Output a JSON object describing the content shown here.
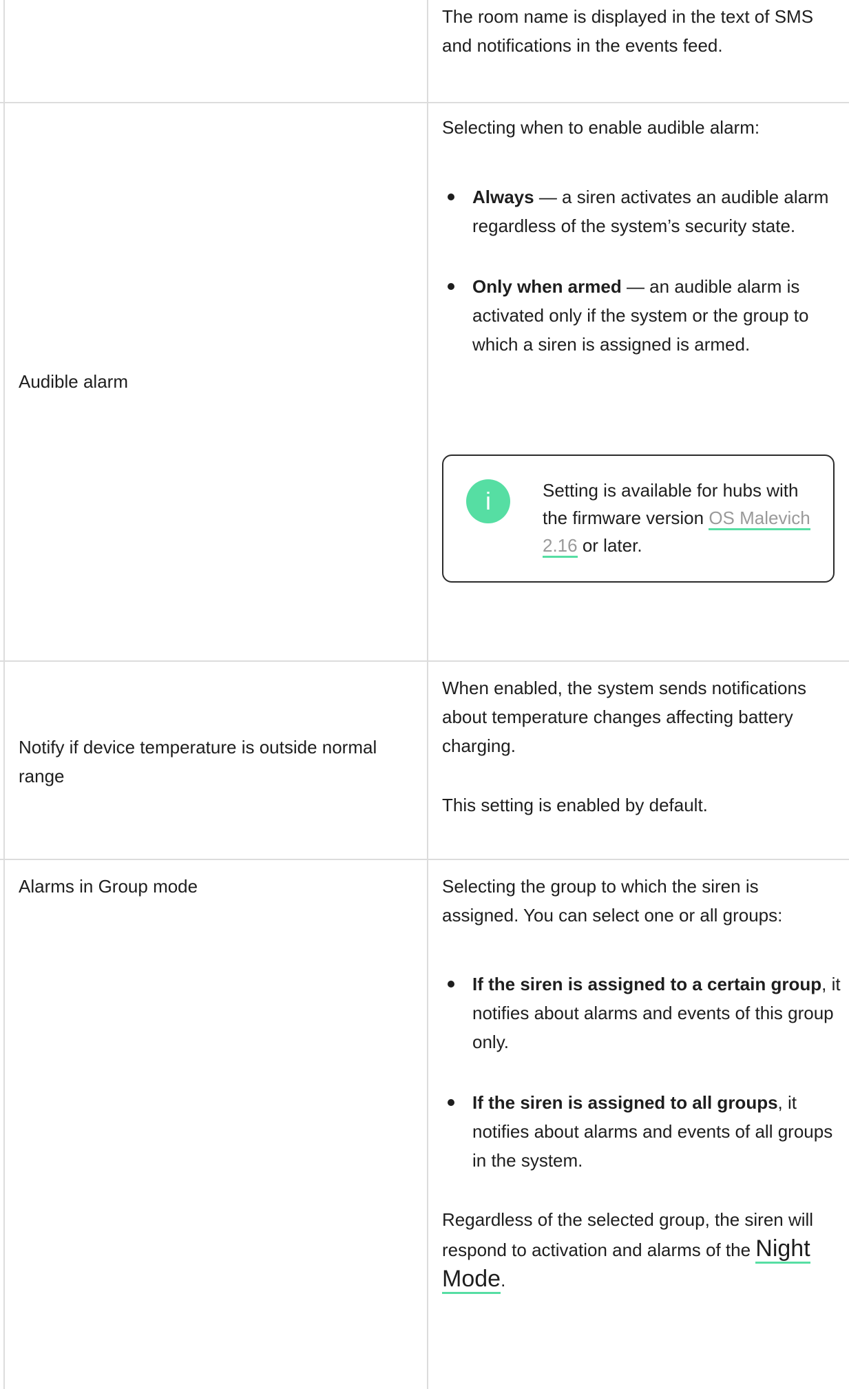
{
  "rows": {
    "room": {
      "description": "The room name is displayed in the text of SMS and notifications in the events feed."
    },
    "audible_alarm": {
      "label": "Audible alarm",
      "intro": "Selecting when to enable audible alarm:",
      "options": [
        {
          "term": "Always",
          "text": " — a siren activates an audible alarm regardless of the system’s security state."
        },
        {
          "term": "Only when armed",
          "text": " — an audible alarm is activated only if the system or the group to which a siren is assigned is armed."
        }
      ],
      "note": {
        "icon": "info-icon",
        "text_before": "Setting is available for hubs with the firmware version ",
        "link_text": "OS Malevich 2.16",
        "text_after": " or later."
      }
    },
    "temperature": {
      "label": "Notify if device temperature is outside normal range",
      "description": "When enabled, the system sends notifications about temperature changes affecting battery charging.",
      "default_note": "This setting is enabled by default."
    },
    "group_mode": {
      "label": "Alarms in Group mode",
      "intro": "Selecting the group to which the siren is assigned. You can select one or all groups:",
      "options": [
        {
          "term": "If the siren is assigned to a certain group",
          "text": ", it notifies about alarms and events of this group only."
        },
        {
          "term": "If the siren is assigned to all groups",
          "text": ", it notifies about alarms and events of all groups in the system."
        }
      ],
      "footer_before": "Regardless of the selected group, the siren will respond to activation and alarms of the ",
      "footer_link": "Night Mode",
      "footer_after": "."
    }
  },
  "colors": {
    "accent": "#56dea3",
    "border": "#dcdcdc",
    "text": "#1e1e1e",
    "link_grey": "#9a9a9a"
  }
}
